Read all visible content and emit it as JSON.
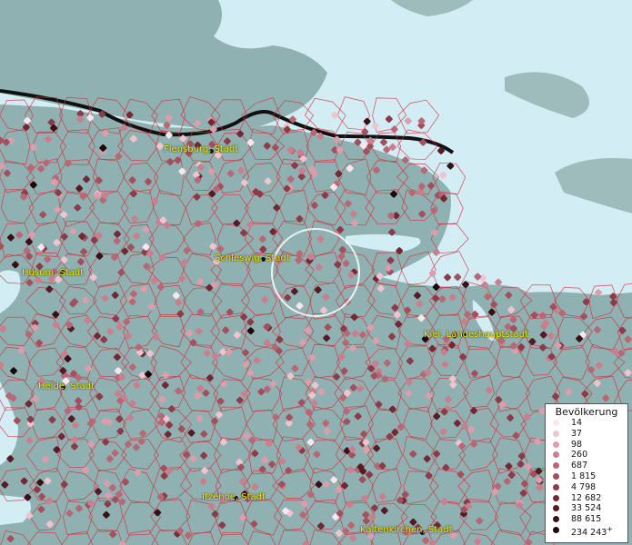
{
  "cities": [
    {
      "id": "flensburg",
      "label": "Flensburg, Stadt"
    },
    {
      "id": "schleswig",
      "label": "Schleswig, Stadt"
    },
    {
      "id": "husum",
      "label": "Husum, Stadt"
    },
    {
      "id": "kiel",
      "label": "Kiel, Landeshauptstadt"
    },
    {
      "id": "heide",
      "label": "Heide, Stadt"
    },
    {
      "id": "itzehoe",
      "label": "Itzehoe, Stadt"
    },
    {
      "id": "kaltenkirchen",
      "label": "Kaltenkirchen, Stadt"
    }
  ],
  "legend": {
    "title": "Bevölkerung",
    "items": [
      {
        "label": "14",
        "color": "#fbe6ee"
      },
      {
        "label": "37",
        "color": "#f0c4cf"
      },
      {
        "label": "98",
        "color": "#dc9eac"
      },
      {
        "label": "260",
        "color": "#c97f8d"
      },
      {
        "label": "687",
        "color": "#b86774"
      },
      {
        "label": "1 815",
        "color": "#a3505e"
      },
      {
        "label": "4 798",
        "color": "#8c3b48"
      },
      {
        "label": "12 682",
        "color": "#722935"
      },
      {
        "label": "33 524",
        "color": "#561b25"
      },
      {
        "label": "88 615",
        "color": "#3a1018"
      },
      {
        "label": "234 243",
        "color": "#1c070b",
        "suffix": "+"
      }
    ]
  },
  "colors": {
    "land": "#8fb1b1",
    "sea": "#d3edf5",
    "border": "#d42c38",
    "national_border": "#111111"
  }
}
